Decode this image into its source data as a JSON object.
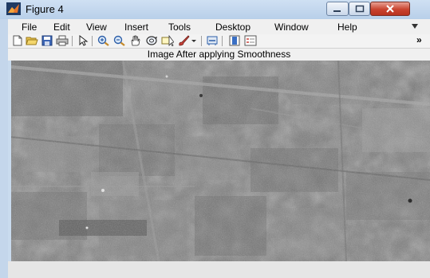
{
  "window": {
    "title": "Figure 4"
  },
  "menu": [
    "File",
    "Edit",
    "View",
    "Insert",
    "Tools",
    "Desktop",
    "Window",
    "Help"
  ],
  "toolbar": {
    "overflow_label": "»"
  },
  "figure": {
    "title": "Image After applying Smoothness"
  },
  "colors": {
    "titlebar": "#c9dbee",
    "close_button": "#c9432f",
    "image_mid_gray": "#7d7d7d"
  },
  "icons": [
    "new-figure-icon",
    "open-file-icon",
    "save-icon",
    "print-icon",
    "edit-plot-icon",
    "zoom-in-icon",
    "zoom-out-icon",
    "pan-icon",
    "rotate-3d-icon",
    "data-cursor-icon",
    "brush-icon",
    "brush-dropdown-icon",
    "link-plot-icon",
    "colorbar-icon",
    "legend-icon"
  ]
}
